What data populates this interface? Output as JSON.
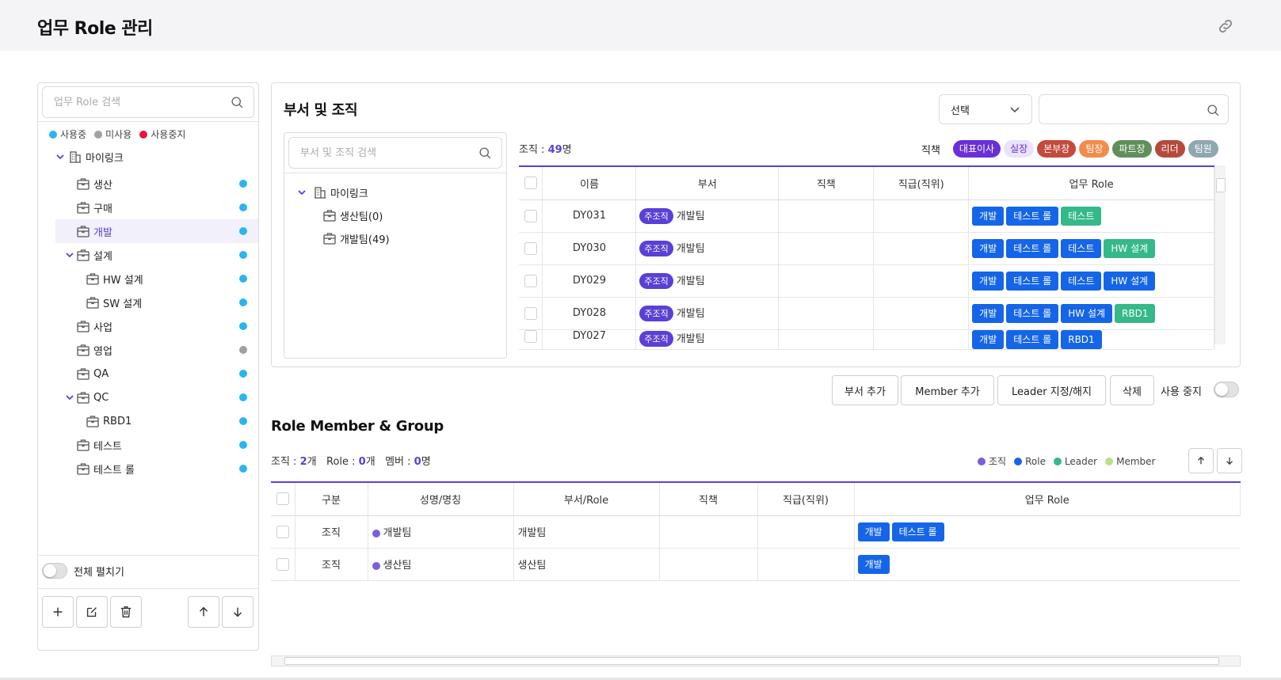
{
  "page": {
    "title": "업무 Role 관리"
  },
  "left": {
    "search_placeholder": "업무 Role 검색",
    "legend": [
      {
        "label": "사용중",
        "color": "#2bb5f0"
      },
      {
        "label": "미사용",
        "color": "#a0a0a0"
      },
      {
        "label": "사용중지",
        "color": "#e8143c"
      }
    ],
    "tree": [
      {
        "label": "마이링크",
        "level": 0,
        "expanded": true,
        "type": "building"
      },
      {
        "label": "생산",
        "level": 1,
        "status": "#2bb5f0"
      },
      {
        "label": "구매",
        "level": 1,
        "status": "#2bb5f0"
      },
      {
        "label": "개발",
        "level": 1,
        "status": "#2bb5f0",
        "selected": true
      },
      {
        "label": "설계",
        "level": 1,
        "status": "#2bb5f0",
        "expanded": true
      },
      {
        "label": "HW 설계",
        "level": 2,
        "status": "#2bb5f0"
      },
      {
        "label": "SW 설계",
        "level": 2,
        "status": "#2bb5f0"
      },
      {
        "label": "사업",
        "level": 1,
        "status": "#2bb5f0"
      },
      {
        "label": "영업",
        "level": 1,
        "status": "#a0a0a0"
      },
      {
        "label": "QA",
        "level": 1,
        "status": "#2bb5f0"
      },
      {
        "label": "QC",
        "level": 1,
        "status": "#2bb5f0",
        "expanded": true
      },
      {
        "label": "RBD1",
        "level": 2,
        "status": "#2bb5f0"
      },
      {
        "label": "테스트",
        "level": 1,
        "status": "#2bb5f0"
      },
      {
        "label": "테스트 롤",
        "level": 1,
        "status": "#2bb5f0"
      }
    ],
    "expand_all_label": "전체 펼치기"
  },
  "dept": {
    "title": "부서 및 조직",
    "select_value": "선택",
    "inner_search_placeholder": "부서 및 조직 검색",
    "inner_tree": [
      {
        "label": "마이링크",
        "level": 0
      },
      {
        "label": "생산팀(0)",
        "level": 1
      },
      {
        "label": "개발팀(49)",
        "level": 1
      }
    ],
    "count_prefix": "조직 : ",
    "count_value": "49",
    "count_suffix": "명",
    "position_label": "직책",
    "positions": [
      {
        "label": "대표이사",
        "bg": "#6a2fd6",
        "fg": "#ffffff"
      },
      {
        "label": "실장",
        "bg": "#e9e3fb",
        "fg": "#6a2fd6"
      },
      {
        "label": "본부장",
        "bg": "#c44a3c",
        "fg": "#ffffff"
      },
      {
        "label": "팀장",
        "bg": "#f28c4b",
        "fg": "#ffffff"
      },
      {
        "label": "파트장",
        "bg": "#5f8f5a",
        "fg": "#ffffff"
      },
      {
        "label": "리더",
        "bg": "#b54a3c",
        "fg": "#ffffff"
      },
      {
        "label": "팀원",
        "bg": "#8fa8b0",
        "fg": "#ffffff"
      }
    ],
    "columns": [
      "이름",
      "부서",
      "직책",
      "직급(직위)",
      "업무 Role"
    ],
    "rows": [
      {
        "name": "DY031",
        "tag": "주조직",
        "dept": "개발팀",
        "roles": [
          [
            "개발",
            "blue"
          ],
          [
            "테스트 롤",
            "blue"
          ],
          [
            "테스트",
            "green"
          ]
        ]
      },
      {
        "name": "DY030",
        "tag": "주조직",
        "dept": "개발팀",
        "roles": [
          [
            "개발",
            "blue"
          ],
          [
            "테스트 롤",
            "blue"
          ],
          [
            "테스트",
            "blue"
          ],
          [
            "HW 설계",
            "green"
          ]
        ]
      },
      {
        "name": "DY029",
        "tag": "주조직",
        "dept": "개발팀",
        "roles": [
          [
            "개발",
            "blue"
          ],
          [
            "테스트 롤",
            "blue"
          ],
          [
            "테스트",
            "blue"
          ],
          [
            "HW 설계",
            "blue"
          ]
        ]
      },
      {
        "name": "DY028",
        "tag": "주조직",
        "dept": "개발팀",
        "roles": [
          [
            "개발",
            "blue"
          ],
          [
            "테스트 롤",
            "blue"
          ],
          [
            "HW 설계",
            "blue"
          ],
          [
            "RBD1",
            "green"
          ]
        ]
      },
      {
        "name": "DY027",
        "tag": "주조직",
        "dept": "개발팀",
        "roles": [
          [
            "개발",
            "blue"
          ],
          [
            "테스트 롤",
            "blue"
          ],
          [
            "RBD1",
            "blue"
          ]
        ]
      }
    ]
  },
  "actions": {
    "add_dept": "부서 추가",
    "add_member": "Member 추가",
    "leader": "Leader 지정/해지",
    "delete": "삭제",
    "use_stop": "사용 중지"
  },
  "rmg": {
    "title": "Role Member & Group",
    "org_label": "조직 : ",
    "org_value": "2",
    "org_unit": "개",
    "role_label": "Role : ",
    "role_value": "0",
    "role_unit": "개",
    "member_label": "멤버 : ",
    "member_value": "0",
    "member_unit": "명",
    "legend": [
      {
        "label": "조직",
        "color": "#7b5ee0"
      },
      {
        "label": "Role",
        "color": "#1565e8"
      },
      {
        "label": "Leader",
        "color": "#35b88a"
      },
      {
        "label": "Member",
        "color": "#b6e08a"
      }
    ],
    "columns": [
      "구분",
      "성명/명칭",
      "부서/Role",
      "직책",
      "직급(직위)",
      "업무 Role"
    ],
    "rows": [
      {
        "type": "조직",
        "name": "개발팀",
        "dept": "개발팀",
        "roles": [
          "개발",
          "테스트 롤"
        ]
      },
      {
        "type": "조직",
        "name": "생산팀",
        "dept": "생산팀",
        "roles": [
          "개발"
        ]
      }
    ]
  }
}
